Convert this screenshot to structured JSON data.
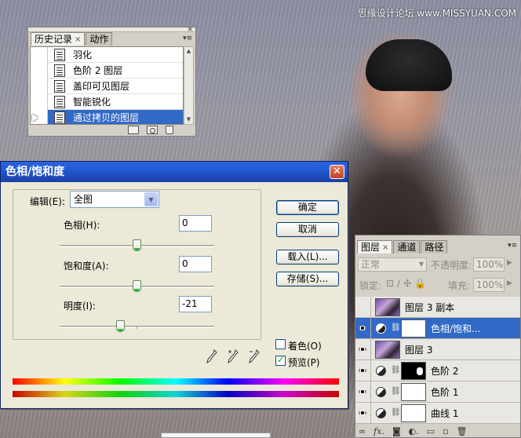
{
  "watermark": "思缘设计论坛 www.MISSYUAN.COM",
  "history": {
    "tabs": [
      {
        "label": "历史记录",
        "active": true
      },
      {
        "label": "动作",
        "active": false
      }
    ],
    "items": [
      {
        "label": "羽化"
      },
      {
        "label": "色阶 2 图层"
      },
      {
        "label": "盖印可见图层"
      },
      {
        "label": "智能锐化"
      },
      {
        "label": "通过拷贝的图层",
        "selected": true
      }
    ]
  },
  "dialog": {
    "title": "色相/饱和度",
    "edit_label": "编辑(E):",
    "edit_value": "全图",
    "hue": {
      "label": "色相(H):",
      "value": "0"
    },
    "saturation": {
      "label": "饱和度(A):",
      "value": "0"
    },
    "lightness": {
      "label": "明度(I):",
      "value": "-21"
    },
    "buttons": {
      "ok": "确定",
      "cancel": "取消",
      "load": "载入(L)...",
      "save": "存储(S)..."
    },
    "colorize": {
      "label": "着色(O)",
      "checked": false
    },
    "preview": {
      "label": "预览(P)",
      "checked": true
    }
  },
  "layers": {
    "tabs": [
      {
        "label": "图层",
        "active": true
      },
      {
        "label": "通道",
        "active": false
      },
      {
        "label": "路径",
        "active": false
      }
    ],
    "blend_mode": "正常",
    "opacity_label": "不透明度:",
    "opacity_value": "100%",
    "lock_label": "锁定:",
    "fill_label": "填充:",
    "fill_value": "100%",
    "rows": [
      {
        "name": "图层 3 副本",
        "visible": false,
        "kind": "photo"
      },
      {
        "name": "色相/饱和...",
        "visible": true,
        "kind": "adjust-white",
        "selected": true
      },
      {
        "name": "图层 3",
        "visible": true,
        "kind": "photo"
      },
      {
        "name": "色阶 2",
        "visible": true,
        "kind": "adjust-mask"
      },
      {
        "name": "色阶 1",
        "visible": true,
        "kind": "adjust-white"
      },
      {
        "name": "曲线 1",
        "visible": true,
        "kind": "adjust-white"
      }
    ],
    "footer_icons": [
      "link-icon",
      "fx-icon",
      "mask-icon",
      "adjustment-icon",
      "group-icon",
      "new-layer-icon",
      "trash-icon"
    ]
  }
}
